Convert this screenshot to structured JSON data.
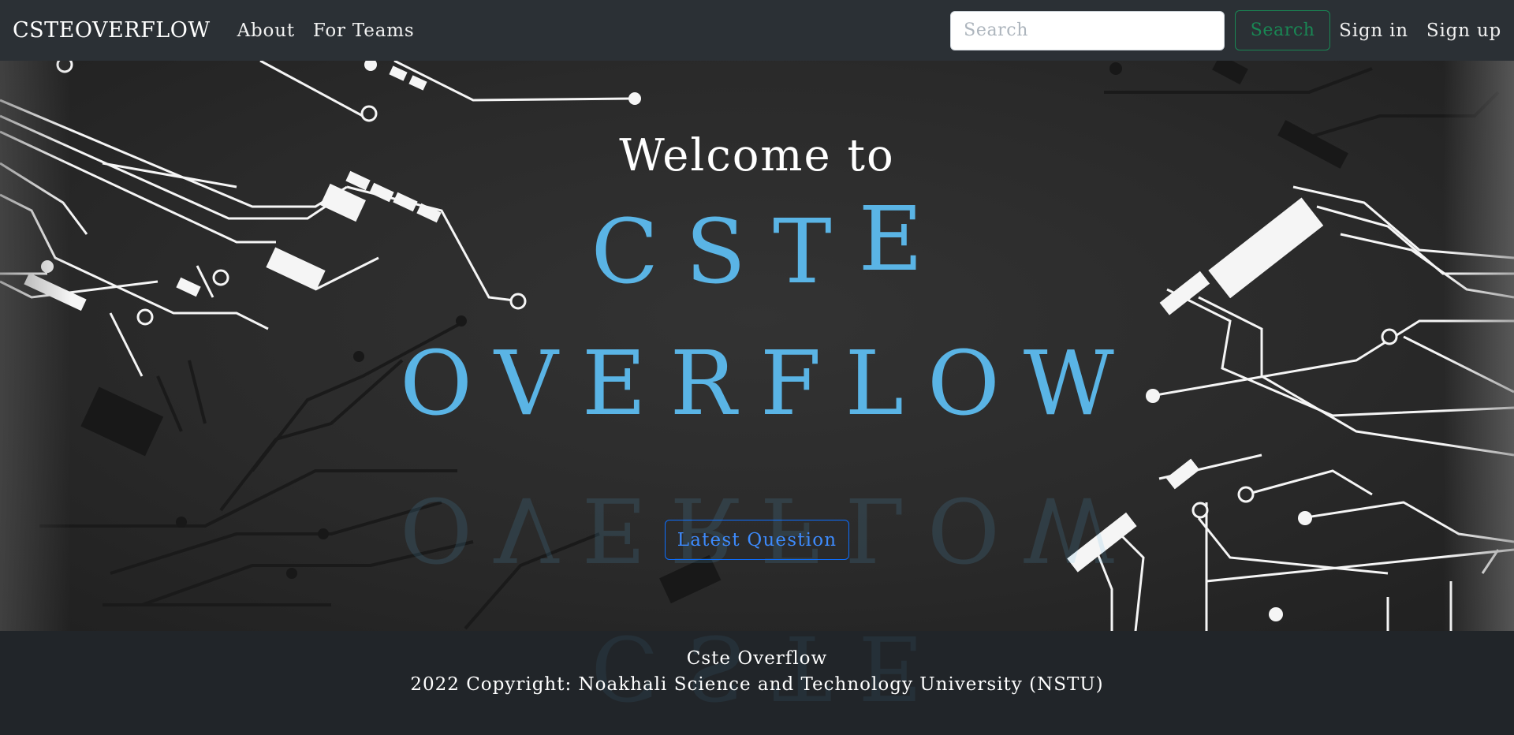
{
  "navbar": {
    "brand": "CSTEOVERFLOW",
    "links": [
      "About",
      "For Teams"
    ],
    "search": {
      "placeholder": "Search",
      "value": "",
      "button_label": "Search"
    },
    "sign_in": "Sign in",
    "sign_up": "Sign up"
  },
  "hero": {
    "welcome": "Welcome to",
    "title_line1": "CST",
    "title_line1_raised": "E",
    "title_line2": "OVERFLOW",
    "reflection_text": "OVERFLOW",
    "latest_button": "Latest Question"
  },
  "footer": {
    "reflection_text": "CSTE",
    "line1": "Cste Overflow",
    "line2": "2022 Copyright: Noakhali Science and Technology University (NSTU)"
  },
  "colors": {
    "accent_blue": "#5ab4e5",
    "navbar_bg": "#2b3035",
    "footer_bg": "#212529",
    "success_green": "#198754",
    "primary_blue": "#0d6efd"
  },
  "icons": [
    "circuit-board-decoration"
  ]
}
